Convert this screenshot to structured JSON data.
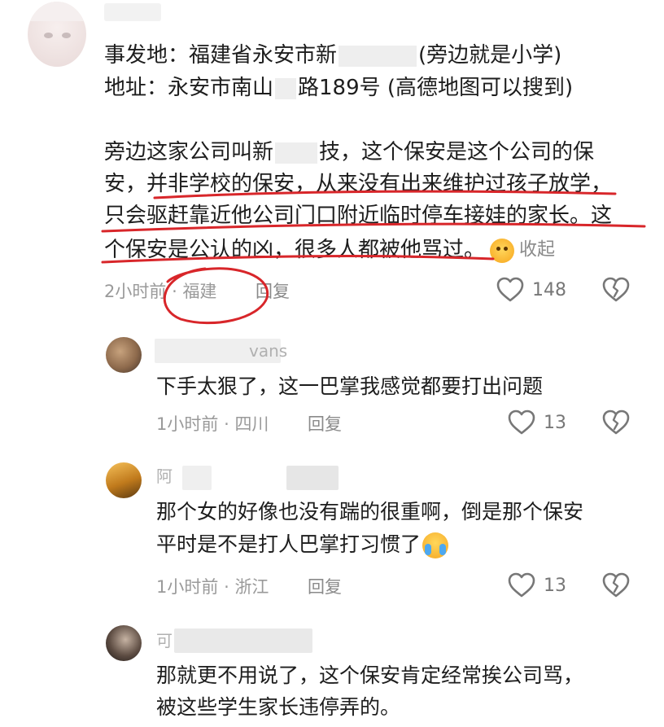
{
  "main_comment": {
    "lines": [
      {
        "before": "事发地：福建省永安市新",
        "after": "(旁边就是小学)"
      },
      {
        "before": "地址：永安市南山",
        "after": "路189号 (高德地图可以搜到)"
      },
      {
        "before": "旁边这家公司叫新",
        "after": "技，这个保安是这个公司的保"
      },
      {
        "text": "安，并非学校的保安，从来没有出来维护过孩子放学，"
      },
      {
        "text": "只会驱赶靠近他公司门口附近临时停车接娃的家长。这"
      },
      {
        "text": "个保安是公认的凶，很多人都被他骂过。"
      }
    ],
    "collapse_label": "收起",
    "time": "2小时前",
    "location": "福建",
    "reply_label": "回复",
    "like_count": "148"
  },
  "replies": [
    {
      "name_fragment": "vans",
      "lines": [
        "下手太狠了，这一巴掌我感觉都要打出问题"
      ],
      "time": "1小时前",
      "location": "四川",
      "reply_label": "回复",
      "like_count": "13"
    },
    {
      "name_fragment": "阿",
      "lines": [
        "那个女的好像也没有踹的很重啊，倒是那个保安",
        "平时是不是打人巴掌打习惯了"
      ],
      "time": "1小时前",
      "location": "浙江",
      "reply_label": "回复",
      "like_count": "13"
    },
    {
      "name_fragment": "可",
      "lines": [
        "那就更不用说了，这个保安肯定经常挨公司骂，",
        "被这些学生家长违停弄的。"
      ]
    }
  ],
  "meta_separator": "·",
  "icons": {
    "like": "heart-outline-icon",
    "dislike": "broken-heart-icon",
    "emoji_main": "smiling-face-emoji-icon",
    "emoji_reply": "loudly-crying-emoji-icon"
  },
  "colors": {
    "text": "#1d1d1d",
    "meta": "#9a9a9a",
    "annotation_red": "#d8262a"
  }
}
